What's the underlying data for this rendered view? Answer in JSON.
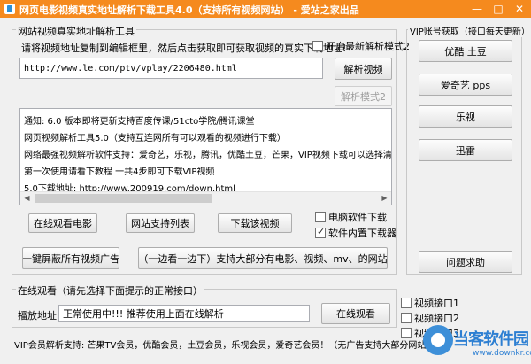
{
  "window": {
    "title": "网页电影视频真实地址解析下载工具4.0（支持所有视频网站） - 爱站之家出品",
    "min_glyph": "—",
    "max_glyph": "□",
    "close_glyph": "✕"
  },
  "parse_group": {
    "title": "网站视频真实地址解析工具",
    "instruction": "请将视频地址复制到编辑框里，然后点击获取即可获取视频的真实下载地址!",
    "mode2_check_label": "开启最新解析模式2",
    "mode2_checked": false,
    "url_value": "http://www.le.com/ptv/vplay/2206480.html",
    "parse_button": "解析视频",
    "mode2_button": "解析模式2",
    "log_lines": [
      "通知: 6.0 版本即将更新支持百度传课/51cto学院/腾讯课堂",
      "网页视频解析工具5.0（支持互连网所有可以观看的视频进行下载）",
      "网络最强视频解析软件支持：爱奇艺，乐视，腾讯，优酷土豆，芒果，VIP视频下载可以选择清晰度",
      "第一次使用请看下教程 一共4步即可下载VIP视频",
      "5.0下载地址: http://www.200919.com/down.html"
    ],
    "watch_online_button": "在线观看电影",
    "site_list_button": "网站支持列表",
    "download_video_button": "下载该视频",
    "pc_download_check_label": "电脑软件下载",
    "pc_download_checked": false,
    "builtin_downloader_check_label": "软件内置下载器",
    "builtin_downloader_checked": true,
    "block_ads_button": "一键屏蔽所有视频广告",
    "side_by_side_button": "（一边看一边下）支持大部分有电影、视频、mv、的网站"
  },
  "vip_group": {
    "title": "VIP账号获取（接口每天更新）",
    "buttons": [
      "优酷 土豆",
      "爱奇艺 pps",
      "乐视",
      "迅雷"
    ],
    "help_button": "问题求助"
  },
  "online_group": {
    "title": "在线观看（请先选择下面提示的正常接口）",
    "address_label": "播放地址:",
    "address_value": "正常使用中!!! 推荐使用上面在线解析",
    "watch_button": "在线观看",
    "interfaces": [
      {
        "label": "视频接口1",
        "checked": false
      },
      {
        "label": "视频接口2",
        "checked": false
      },
      {
        "label": "视频接口3",
        "checked": false
      }
    ]
  },
  "footer": {
    "text": "VIP会员解析支持: 芒果TV会员，优酷会员，土豆会员，乐视会员，爱奇艺会员！（无广告支持大部分网站）"
  },
  "watermark": {
    "brand": "当客软件园",
    "url": "www.downkr.com",
    "color": "#2d7fd2"
  }
}
